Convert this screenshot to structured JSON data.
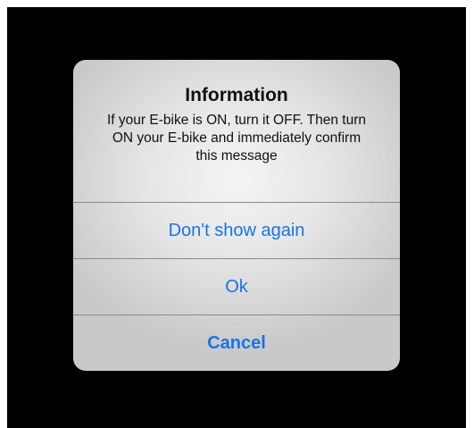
{
  "dialog": {
    "title": "Information",
    "message": "If your E-bike is ON, turn it OFF. Then turn ON your E-bike and immediately confirm this message",
    "actions": [
      {
        "label": "Don't show again"
      },
      {
        "label": "Ok"
      },
      {
        "label": "Cancel"
      }
    ]
  },
  "colors": {
    "action_text": "#1a73e8",
    "screen_background": "#000000",
    "dialog_background": "#e6e6e6"
  }
}
